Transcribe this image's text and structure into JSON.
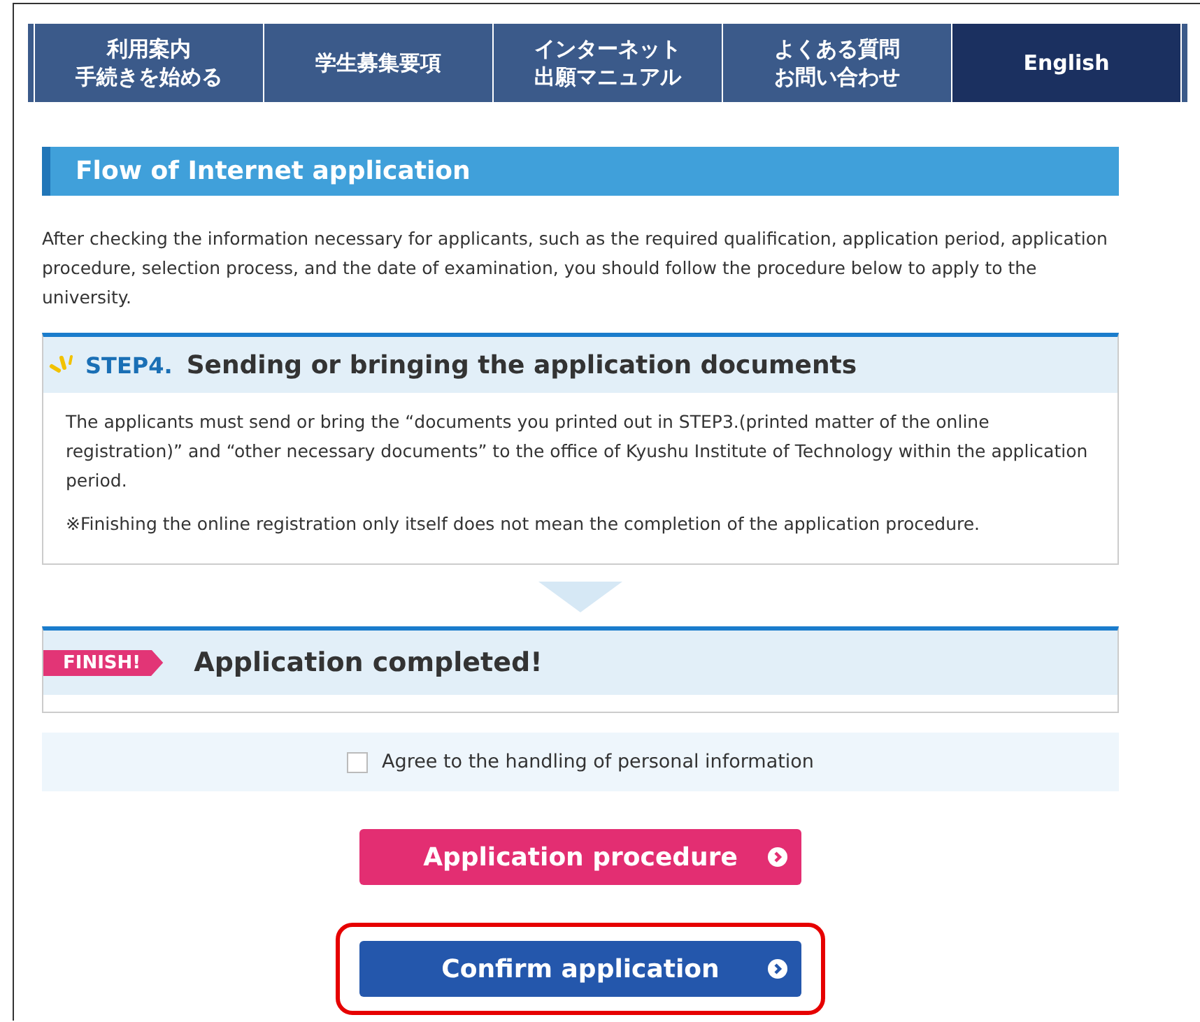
{
  "nav": {
    "tabs": [
      {
        "lines": [
          "利用案内",
          "手続きを始める"
        ],
        "selected": false
      },
      {
        "lines": [
          "学生募集要項"
        ],
        "selected": false
      },
      {
        "lines": [
          "インターネット",
          "出願マニュアル"
        ],
        "selected": false
      },
      {
        "lines": [
          "よくある質問",
          "お問い合わせ"
        ],
        "selected": false
      },
      {
        "lines": [
          "English"
        ],
        "selected": true
      }
    ]
  },
  "heading": "Flow of Internet application",
  "intro": "After checking the information necessary for applicants, such as the required qualification, application period, application procedure, selection process, and the date of examination, you should follow the procedure below to apply to the university.",
  "step": {
    "label": "STEP4.",
    "title": "Sending or bringing the application documents",
    "paragraphs": [
      "The applicants must send or bring the “documents you printed out in STEP3.(printed matter of the online registration)” and “other necessary documents” to the office of Kyushu Institute of Technology within the application period.",
      "※Finishing the online registration only itself does not mean the completion of the application procedure."
    ]
  },
  "finish": {
    "badge": "FINISH!",
    "title": "Application completed!"
  },
  "agree": {
    "label": "Agree to the handling of personal information",
    "checked": false
  },
  "buttons": [
    {
      "label": "Application procedure",
      "kind": "pink",
      "highlighted": false
    },
    {
      "label": "Confirm application",
      "kind": "blue",
      "highlighted": true
    }
  ]
}
